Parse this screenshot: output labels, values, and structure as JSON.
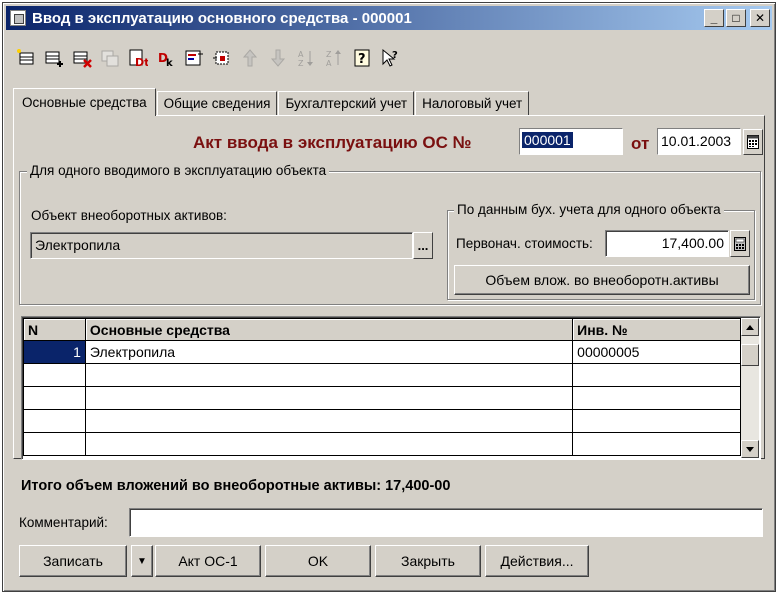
{
  "window": {
    "title": "Ввод в эксплуатацию основного средства - 000001",
    "minimize_glyph": "_",
    "maximize_glyph": "□",
    "close_glyph": "✕"
  },
  "toolbar": {
    "icons": [
      "new-row-icon",
      "add-row-icon",
      "delete-row-icon",
      "copy-row-icon",
      "debit-icon",
      "credit-icon",
      "edit-icon",
      "export-icon",
      "move-up-icon",
      "move-down-icon",
      "sort-ascending-icon",
      "sort-descending-icon",
      "help-icon",
      "context-help-icon"
    ]
  },
  "tabs": [
    {
      "label": "Основные средства",
      "active": true
    },
    {
      "label": "Общие сведения",
      "active": false
    },
    {
      "label": "Бухгалтерский учет",
      "active": false
    },
    {
      "label": "Налоговый учет",
      "active": false
    }
  ],
  "act": {
    "title": "Акт ввода в эксплуатацию ОС №",
    "number": "000001",
    "from_label": "от",
    "date": "10.01.2003"
  },
  "object_group": {
    "legend": "Для одного вводимого в эксплуатацию объекта",
    "asset_label": "Объект внеоборотных активов:",
    "asset_value": "Электропила",
    "select_button": "...",
    "accounting_legend": "По данным бух. учета для одного объекта",
    "cost_label": "Первонач. стоимость:",
    "cost_value": "17,400.00",
    "investments_button": "Объем влож. во внеоборотн.активы"
  },
  "table": {
    "columns": [
      "N",
      "Основные средства",
      "Инв. №"
    ],
    "rows": [
      {
        "n": "1",
        "asset": "Электропила",
        "inv": "00000005"
      },
      {
        "n": "",
        "asset": "",
        "inv": ""
      },
      {
        "n": "",
        "asset": "",
        "inv": ""
      },
      {
        "n": "",
        "asset": "",
        "inv": ""
      },
      {
        "n": "",
        "asset": "",
        "inv": ""
      }
    ]
  },
  "total_text": "Итого объем вложений во внеоборотные активы: 17,400-00",
  "comment": {
    "label": "Комментарий:",
    "value": ""
  },
  "buttons": {
    "save": "Записать",
    "dropdown": "▼",
    "act_os1": "Акт ОС-1",
    "ok": "OK",
    "close": "Закрыть",
    "actions": "Действия..."
  },
  "colors": {
    "window_bg": "#d4d0c8",
    "title_gradient_start": "#0a246a",
    "title_gradient_end": "#a6caf0",
    "act_title": "#7a1010",
    "selection": "#0a246a"
  }
}
